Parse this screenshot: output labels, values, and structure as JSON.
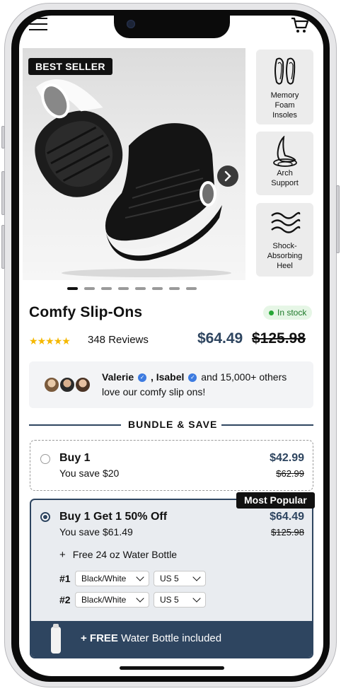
{
  "gallery": {
    "badge": "BEST SELLER",
    "features": [
      {
        "icon": "insole-icon",
        "label_lines": [
          "Memory",
          "Foam",
          "Insoles"
        ]
      },
      {
        "icon": "arch-foot-icon",
        "label_lines": [
          "Arch",
          "Support"
        ]
      },
      {
        "icon": "waves-icon",
        "label_lines": [
          "Shock-",
          "Absorbing",
          "Heel"
        ]
      }
    ],
    "slide_count": 8,
    "active_slide": 1
  },
  "product": {
    "title": "Comfy Slip-Ons",
    "stock": "In stock",
    "rating": 5,
    "reviews": "348 Reviews",
    "price": "$64.49",
    "old_price": "$125.98"
  },
  "social_proof": {
    "name1": "Valerie",
    "name2": ", Isabel",
    "rest": "and 15,000+ others",
    "line2": "love our comfy slip ons!"
  },
  "bundle": {
    "section_title": "BUNDLE & SAVE",
    "options": [
      {
        "title": "Buy 1",
        "save": "You save $20",
        "price": "$42.99",
        "old_price": "$62.99",
        "selected": false
      },
      {
        "title": "Buy 1 Get 1 50% Off",
        "save": "You save $61.49",
        "price": "$64.49",
        "old_price": "$125.98",
        "selected": true,
        "badge": "Most Popular"
      }
    ],
    "gift_plus": "+",
    "gift": "Free 24 oz Water Bottle",
    "variants": [
      {
        "label": "#1",
        "color": "Black/White",
        "size": "US 5"
      },
      {
        "label": "#2",
        "color": "Black/White",
        "size": "US 5"
      }
    ],
    "free_bar_bold": "+ FREE",
    "free_bar_text": " Water Bottle included"
  },
  "colors": {
    "accent": "#2e4560",
    "star": "#f5b800",
    "in_stock": "#27a737",
    "verified": "#3d7be0"
  }
}
